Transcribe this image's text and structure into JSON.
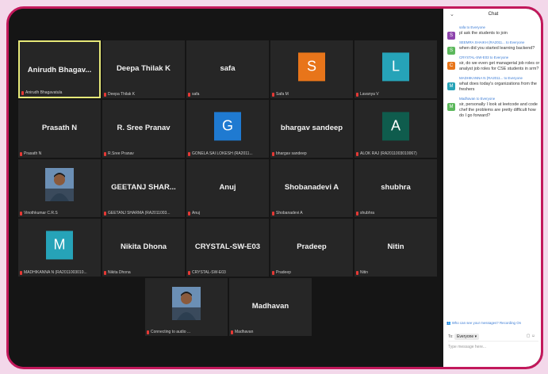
{
  "colors": {
    "frame": "#c2185b",
    "active_border": "#e6e878",
    "mic_muted": "#e53935"
  },
  "gallery": {
    "rows": [
      [
        {
          "name": "Anirudh  Bhagav...",
          "label": "Anirudh Bhagavatula",
          "active": true
        },
        {
          "name": "Deepa Thilak K",
          "label": "Deepa Thilak K"
        },
        {
          "name": "safa",
          "label": "safa"
        },
        {
          "initial": "S",
          "color": "#e8751a",
          "label": "Safa M"
        },
        {
          "initial": "L",
          "color": "#26a3b8",
          "label": "Lavanya V"
        }
      ],
      [
        {
          "name": "Prasath N",
          "label": "Prasath N"
        },
        {
          "name": "R. Sree Pranav",
          "label": "R.Sree Pranav"
        },
        {
          "initial": "G",
          "color": "#1f7ad1",
          "label": "GONELA SAI LOKESH (RA2011..."
        },
        {
          "name": "bhargav sandeep",
          "label": "bhargav sandeep"
        },
        {
          "initial": "A",
          "color": "#0f5c4d",
          "label": "ALOK RAJ (RA2011003010067)"
        }
      ],
      [
        {
          "photo": true,
          "label": "Vinothkumar C.R.S"
        },
        {
          "name": "GEETANJ SHAR...",
          "label": "GEETANJ SHARMA (RA2011003..."
        },
        {
          "name": "Anuj",
          "label": "Anuj"
        },
        {
          "name": "Shobanadevi A",
          "label": "Shobanadevi A"
        },
        {
          "name": "shubhra",
          "label": "shubhra"
        }
      ],
      [
        {
          "initial": "M",
          "color": "#26a3b8",
          "label": "MADHIKANNA N (RA2011003010..."
        },
        {
          "name": "Nikita Dhona",
          "label": "Nikita Dhona"
        },
        {
          "name": "CRYSTAL-SW-E03",
          "label": "CRYSTAL-SW-E03"
        },
        {
          "name": "Pradeep",
          "label": "Pradeep"
        },
        {
          "name": "Nitin",
          "label": "Nitin"
        }
      ],
      [
        {
          "photo": true,
          "label": "Connecting to audio ..."
        },
        {
          "name": "Madhavan",
          "label": "Madhavan"
        }
      ]
    ]
  },
  "chat": {
    "title": "Chat",
    "messages": [
      {
        "sender": "safa to Everyone",
        "initial": "S",
        "color": "#8e44ad",
        "text": "pl ask the students to join"
      },
      {
        "sender": "SEEMRA SHAIKH (RA2011... to Everyone",
        "initial": "S",
        "color": "#5cb85c",
        "text": "when did you started learning backend?"
      },
      {
        "sender": "CRYSTAL-SW-E03 to Everyone",
        "initial": "C",
        "color": "#e8751a",
        "text": "sir, do we even get managerial job roles or analyst job roles for CSE students in srm?"
      },
      {
        "sender": "MADHIKANNA N (RA2011... to Everyone",
        "initial": "M",
        "color": "#26a3b8",
        "text": "what does today's organizations from the freshers"
      },
      {
        "sender": "Madhavan to Everyone",
        "initial": "M",
        "color": "#5cb85c",
        "text": "sir, personally I look at leetcode and code chef the problems are pretty difficult how do I go forward?"
      }
    ],
    "privacy_note": "Who can see your messages? Recording On",
    "to_label": "To:",
    "to_value": "Everyone ▾",
    "tools": "▢ ☺",
    "input_placeholder": "Type message here..."
  }
}
